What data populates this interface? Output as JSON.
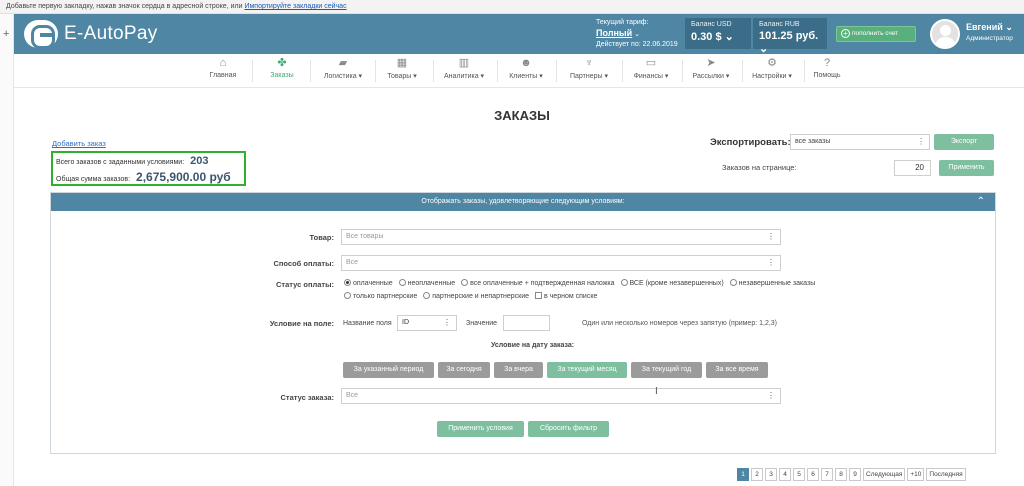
{
  "bookmarks_bar": {
    "text": "Добавьте первую закладку, нажав значок сердца в адресной строке, или ",
    "link": "Импортируйте закладки сейчас"
  },
  "header": {
    "logo": "E-AutoPay",
    "tariff_label": "Текущий тариф:",
    "tariff_plan": "Полный",
    "tariff_valid": "Действует по: 22.06.2019",
    "balance_usd_label": "Баланс USD",
    "balance_usd_value": "0.30 $",
    "balance_rub_label": "Баланс RUB",
    "balance_rub_value": "101.25 руб.",
    "topup_label": "пополнить счет",
    "user_name": "Евгений",
    "user_role": "Администратор"
  },
  "nav": [
    {
      "label": "Главная",
      "icon": "home-icon"
    },
    {
      "label": "Заказы",
      "icon": "orders-icon"
    },
    {
      "label": "Логистика ▾",
      "icon": "truck-icon"
    },
    {
      "label": "Товары ▾",
      "icon": "products-icon"
    },
    {
      "label": "Аналитика ▾",
      "icon": "chart-icon"
    },
    {
      "label": "Клиенты ▾",
      "icon": "clients-icon"
    },
    {
      "label": "Партнеры ▾",
      "icon": "handshake-icon"
    },
    {
      "label": "Финансы ▾",
      "icon": "card-icon"
    },
    {
      "label": "Рассылки ▾",
      "icon": "send-icon"
    },
    {
      "label": "Настройки ▾",
      "icon": "gear-icon"
    },
    {
      "label": "Помощь",
      "icon": "help-icon"
    }
  ],
  "page_title": "ЗАКАЗЫ",
  "add_order_link": "Добавить заказ",
  "summary": {
    "total_orders_label": "Всего заказов с заданными условиями:",
    "total_orders_value": "203",
    "total_sum_label": "Общая сумма заказов:",
    "total_sum_value": "2,675,900.00 руб"
  },
  "export": {
    "label": "Экспортировать:",
    "selected": "все заказы",
    "button": "Экспорт"
  },
  "per_page": {
    "label": "Заказов на странице:",
    "value": "20",
    "button": "Применить"
  },
  "filter_panel": {
    "header": "Отображать заказы, удовлетворяющие следующим условиям:",
    "product_label": "Товар:",
    "product_placeholder": "Все товары",
    "payment_label": "Способ оплаты:",
    "payment_placeholder": "Все",
    "pay_status_label": "Статус оплаты:",
    "pay_status_options": [
      {
        "label": "оплаченные",
        "selected": true
      },
      {
        "label": "неоплаченные",
        "selected": false
      },
      {
        "label": "все оплаченные + подтвержденная наложка",
        "selected": false
      },
      {
        "label": "ВСЕ (кроме незавершенных)",
        "selected": false
      },
      {
        "label": "незавершенные заказы",
        "selected": false
      },
      {
        "label": "только партнерские",
        "selected": false
      },
      {
        "label": "партнерские и непартнерские",
        "selected": false
      }
    ],
    "blacklist_checkbox": "в черном списке",
    "field_condition_label": "Условие на поле:",
    "field_name_label": "Название поля",
    "field_name_value": "ID",
    "value_label": "Значение",
    "hint": "Один или несколько номеров через запятую (пример: 1,2,3)",
    "date_condition_label": "Условие на дату заказа:",
    "date_buttons": [
      "За указанный период",
      "За сегодня",
      "За вчера",
      "За текущий месяц",
      "За текущий год",
      "За все время"
    ],
    "date_active_index": 3,
    "order_status_label": "Статус заказа:",
    "order_status_placeholder": "Все",
    "apply_button": "Применить условия",
    "reset_button": "Сбросить фильтр"
  },
  "pagination": {
    "pages": [
      "1",
      "2",
      "3",
      "4",
      "5",
      "6",
      "7",
      "8",
      "9"
    ],
    "current": "1",
    "next": "Следующая",
    "plus10": "+10",
    "last": "Последняя"
  }
}
